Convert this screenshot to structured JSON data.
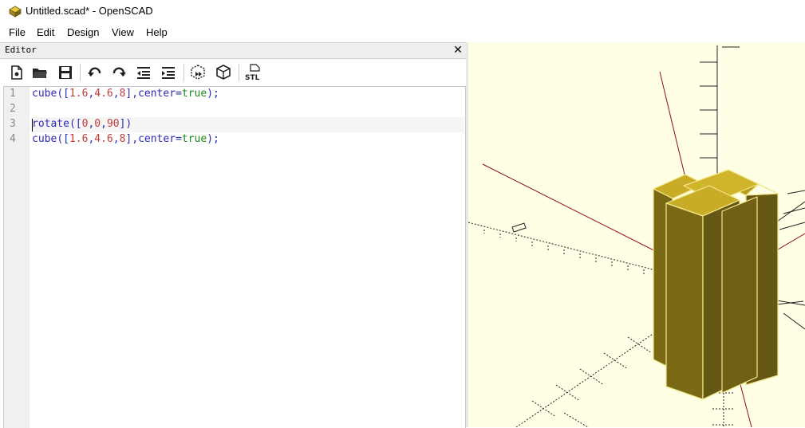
{
  "window": {
    "title": "Untitled.scad* - OpenSCAD",
    "icon": "openscad-app-icon"
  },
  "menu": {
    "items": [
      "File",
      "Edit",
      "Design",
      "View",
      "Help"
    ]
  },
  "editor_panel": {
    "title": "Editor",
    "close_glyph": "✕"
  },
  "toolbar": {
    "buttons": [
      {
        "name": "new-file-icon"
      },
      {
        "name": "open-file-icon"
      },
      {
        "name": "save-file-icon"
      },
      {
        "name": "undo-icon"
      },
      {
        "name": "redo-icon"
      },
      {
        "name": "unindent-icon"
      },
      {
        "name": "indent-icon"
      },
      {
        "name": "preview-icon"
      },
      {
        "name": "render-icon"
      },
      {
        "name": "export-stl-icon",
        "label": "STL"
      }
    ]
  },
  "code": {
    "line_numbers": [
      "1",
      "2",
      "3",
      "4"
    ],
    "lines": [
      [
        {
          "t": "cube",
          "k": "kw"
        },
        {
          "t": "([",
          "k": "p"
        },
        {
          "t": "1.6",
          "k": "num"
        },
        {
          "t": ",",
          "k": "p"
        },
        {
          "t": "4.6",
          "k": "num"
        },
        {
          "t": ",",
          "k": "p"
        },
        {
          "t": "8",
          "k": "num"
        },
        {
          "t": "],center=",
          "k": "p"
        },
        {
          "t": "true",
          "k": "bool"
        },
        {
          "t": ");",
          "k": "p"
        }
      ],
      [],
      [
        {
          "t": "rotate",
          "k": "kw"
        },
        {
          "t": "([",
          "k": "p"
        },
        {
          "t": "0",
          "k": "num"
        },
        {
          "t": ",",
          "k": "p"
        },
        {
          "t": "0",
          "k": "num"
        },
        {
          "t": ",",
          "k": "p"
        },
        {
          "t": "90",
          "k": "num"
        },
        {
          "t": "])",
          "k": "p"
        }
      ],
      [
        {
          "t": "cube",
          "k": "kw"
        },
        {
          "t": "([",
          "k": "p"
        },
        {
          "t": "1.6",
          "k": "num"
        },
        {
          "t": ",",
          "k": "p"
        },
        {
          "t": "4.6",
          "k": "num"
        },
        {
          "t": ",",
          "k": "p"
        },
        {
          "t": "8",
          "k": "num"
        },
        {
          "t": "],center=",
          "k": "p"
        },
        {
          "t": "true",
          "k": "bool"
        },
        {
          "t": ");",
          "k": "p"
        }
      ]
    ],
    "current_line": 3
  },
  "colors": {
    "viewport_bg": "#ffffe5",
    "model_top": "#c8ac28",
    "model_side_light": "#7a6a16",
    "model_side_dark": "#655714",
    "axis": "#8b1010"
  }
}
